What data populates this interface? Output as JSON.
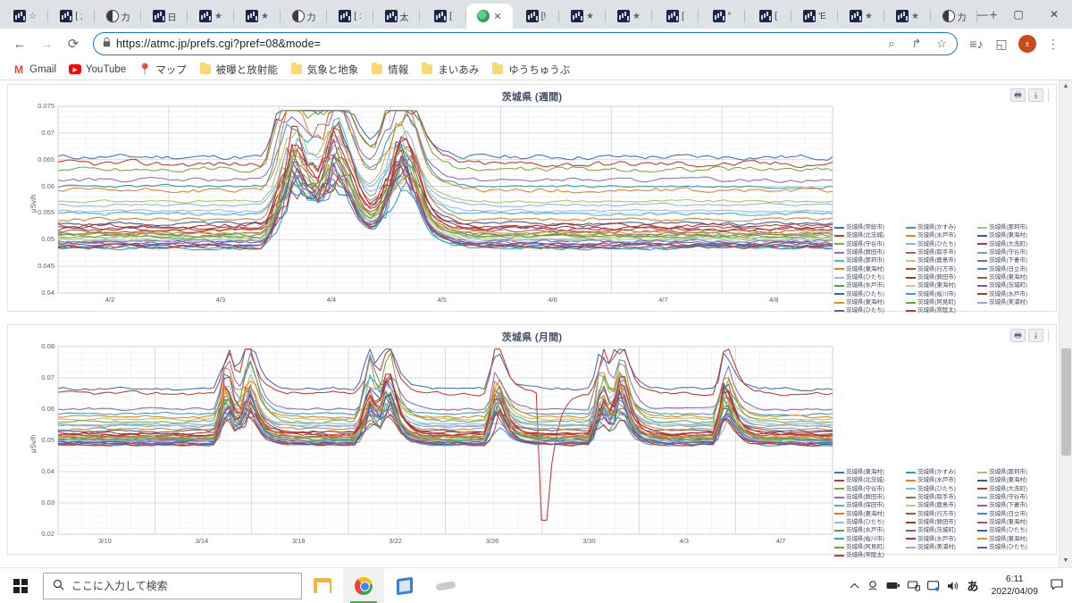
{
  "window": {
    "minimize": "—",
    "maximize": "▢",
    "close": "✕",
    "tab_list_chevron": "⌄"
  },
  "tabs": [
    {
      "favicon": "chart-favicon",
      "text": "",
      "trailing": "☆",
      "active": false
    },
    {
      "favicon": "chart-favicon",
      "text": "[ ;",
      "trailing": "",
      "active": false
    },
    {
      "favicon": "globe-favicon",
      "text": "力",
      "trailing": "",
      "active": false
    },
    {
      "favicon": "chart-favicon",
      "text": "日",
      "trailing": "",
      "active": false
    },
    {
      "favicon": "chart-favicon",
      "text": "",
      "trailing": "★",
      "active": false
    },
    {
      "favicon": "chart-favicon",
      "text": "",
      "trailing": "★",
      "active": false
    },
    {
      "favicon": "globe-favicon",
      "text": "力",
      "trailing": "",
      "active": false
    },
    {
      "favicon": "chart-favicon",
      "text": "[ :",
      "trailing": "",
      "active": false
    },
    {
      "favicon": "chart-favicon",
      "text": "太",
      "trailing": "",
      "active": false
    },
    {
      "favicon": "chart-favicon",
      "text": "[",
      "trailing": "",
      "active": false
    },
    {
      "favicon": "world-favicon",
      "text": "",
      "trailing": "✕",
      "active": true
    },
    {
      "favicon": "chart-favicon",
      "text": "[!",
      "trailing": "",
      "active": false
    },
    {
      "favicon": "chart-favicon",
      "text": "",
      "trailing": "★",
      "active": false
    },
    {
      "favicon": "chart-favicon",
      "text": "",
      "trailing": "★",
      "active": false
    },
    {
      "favicon": "chart-favicon",
      "text": "[",
      "trailing": "",
      "active": false
    },
    {
      "favicon": "chart-favicon",
      "text": "°",
      "trailing": "",
      "active": false
    },
    {
      "favicon": "chart-favicon",
      "text": "[",
      "trailing": "",
      "active": false
    },
    {
      "favicon": "chart-favicon",
      "text": "'E",
      "trailing": "",
      "active": false
    },
    {
      "favicon": "chart-favicon",
      "text": "",
      "trailing": "★",
      "active": false
    },
    {
      "favicon": "chart-favicon",
      "text": "",
      "trailing": "★",
      "active": false
    },
    {
      "favicon": "globe-favicon",
      "text": "力",
      "trailing": "",
      "active": false
    }
  ],
  "newtab_label": "+",
  "toolbar": {
    "back": "←",
    "forward": "→",
    "reload": "⟳",
    "url": "https://atmc.jp/prefs.cgi?pref=08&mode=",
    "url_bold_part": "atmc.jp",
    "lock_icon": "🔒",
    "omni_search": "⌕",
    "omni_share": "↱",
    "omni_star": "☆",
    "reading_list": "≡♪",
    "side_panel": "◱",
    "avatar_letter": "±",
    "menu": "⋮"
  },
  "bookmarks": [
    {
      "icon": "gmail-icon",
      "label": "Gmail"
    },
    {
      "icon": "youtube-icon",
      "label": "YouTube"
    },
    {
      "icon": "maps-pin-icon",
      "label": "マップ"
    },
    {
      "icon": "folder-icon",
      "label": "被曝と放射能"
    },
    {
      "icon": "folder-icon",
      "label": "気象と地象"
    },
    {
      "icon": "folder-icon",
      "label": "情報"
    },
    {
      "icon": "folder-icon",
      "label": "まいあみ"
    },
    {
      "icon": "folder-icon",
      "label": "ゆうちゅうぶ"
    }
  ],
  "chart_tools": {
    "print": "🖶",
    "download": "⤓"
  },
  "chart_data": [
    {
      "type": "line",
      "title": "茨城県 (週間)",
      "xlabel": "",
      "ylabel": "μSv/h",
      "ylim": [
        0.04,
        0.075
      ],
      "yticks": [
        "0.075",
        "0.07",
        "0.065",
        "0.06",
        "0.055",
        "0.05",
        "0.045",
        "0.04"
      ],
      "xticks": [
        "4/2",
        "4/3",
        "4/4",
        "4/5",
        "4/6",
        "4/7",
        "4/8"
      ],
      "grid": true,
      "legend_position": "right",
      "series": [
        {
          "name": "茨城県(常総市)",
          "color": "#3c6fb5",
          "baseline": 0.0655,
          "amp": 0.002,
          "seed": 11
        },
        {
          "name": "茨城県(かすみ)",
          "color": "#2e9fb8",
          "baseline": 0.06,
          "amp": 0.0012,
          "seed": 23
        },
        {
          "name": "茨城県(那珂市)",
          "color": "#a9c46c",
          "baseline": 0.0572,
          "amp": 0.001,
          "seed": 31
        },
        {
          "name": "茨城県(北茨城)",
          "color": "#c0392b",
          "baseline": 0.0642,
          "amp": 0.0025,
          "seed": 42
        },
        {
          "name": "茨城県(水戸市)",
          "color": "#e8821e",
          "baseline": 0.0592,
          "amp": 0.0018,
          "seed": 57
        },
        {
          "name": "茨城県(東海村)",
          "color": "#2e5f9e",
          "baseline": 0.053,
          "amp": 0.0014,
          "seed": 63
        },
        {
          "name": "茨城県(守谷市)",
          "color": "#7ba83c",
          "baseline": 0.0632,
          "amp": 0.0022,
          "seed": 74
        },
        {
          "name": "茨城県(ひたち)",
          "color": "#93b3d8",
          "baseline": 0.0565,
          "amp": 0.001,
          "seed": 85
        },
        {
          "name": "茨城県(大洗町)",
          "color": "#b03a3a",
          "baseline": 0.052,
          "amp": 0.0016,
          "seed": 96
        },
        {
          "name": "茨城県(鉾田市)",
          "color": "#8e6fae",
          "baseline": 0.0612,
          "amp": 0.0016,
          "seed": 107
        },
        {
          "name": "茨城県(取手市)",
          "color": "#9c6b55",
          "baseline": 0.0512,
          "amp": 0.0013,
          "seed": 118
        },
        {
          "name": "茨城県(守谷市)",
          "color": "#6fae8e",
          "baseline": 0.0505,
          "amp": 0.0012,
          "seed": 129
        },
        {
          "name": "茨城県(那珂市)",
          "color": "#4fb7c9",
          "baseline": 0.0548,
          "amp": 0.0015,
          "seed": 140
        },
        {
          "name": "茨城県(鹿島市)",
          "color": "#b9cf8a",
          "baseline": 0.05,
          "amp": 0.0011,
          "seed": 151
        },
        {
          "name": "茨城県(下妻市)",
          "color": "#8b5fa8",
          "baseline": 0.0497,
          "amp": 0.0014,
          "seed": 162
        },
        {
          "name": "茨城県(東海村)",
          "color": "#e07b28",
          "baseline": 0.0538,
          "amp": 0.0013,
          "seed": 173
        },
        {
          "name": "茨城県(行方市)",
          "color": "#a6543f",
          "baseline": 0.0492,
          "amp": 0.0012,
          "seed": 184
        },
        {
          "name": "茨城県(日立市)",
          "color": "#3a93c4",
          "baseline": 0.0486,
          "amp": 0.0012,
          "seed": 195
        },
        {
          "name": "茨城県(ひたち)",
          "color": "#9bb7dd",
          "baseline": 0.0554,
          "amp": 0.001,
          "seed": 206
        },
        {
          "name": "茨城県(鉾田市)",
          "color": "#b5322c",
          "baseline": 0.0527,
          "amp": 0.0018,
          "seed": 217
        },
        {
          "name": "茨城県(東海村)",
          "color": "#a05a52",
          "baseline": 0.0516,
          "amp": 0.0014,
          "seed": 228
        },
        {
          "name": "茨城県(水戸市)",
          "color": "#5a9e45",
          "baseline": 0.0509,
          "amp": 0.0013,
          "seed": 239
        },
        {
          "name": "茨城県(東海村)",
          "color": "#b7cf84",
          "baseline": 0.0503,
          "amp": 0.0012,
          "seed": 250
        },
        {
          "name": "茨城県(茨城町)",
          "color": "#7a5ba0",
          "baseline": 0.0494,
          "amp": 0.0013,
          "seed": 261
        },
        {
          "name": "茨城県(ひたち)",
          "color": "#32659e",
          "baseline": 0.0489,
          "amp": 0.0012,
          "seed": 272
        },
        {
          "name": "茨城県(桜川市)",
          "color": "#2fa8b5",
          "baseline": 0.0484,
          "amp": 0.0011,
          "seed": 283
        },
        {
          "name": "茨城県(水戸市)",
          "color": "#bb2f2f",
          "baseline": 0.0522,
          "amp": 0.0015,
          "seed": 294
        },
        {
          "name": "茨城県(東海村)",
          "color": "#e8901f",
          "baseline": 0.0512,
          "amp": 0.0014,
          "seed": 305
        },
        {
          "name": "茨城県(阿見町)",
          "color": "#6ea33a",
          "baseline": 0.0506,
          "amp": 0.0013,
          "seed": 316
        },
        {
          "name": "茨城県(美浦村)",
          "color": "#8fb0d6",
          "baseline": 0.0498,
          "amp": 0.0012,
          "seed": 327
        },
        {
          "name": "茨城県(ひたち)",
          "color": "#7b55a5",
          "baseline": 0.0491,
          "amp": 0.0012,
          "seed": 338
        },
        {
          "name": "茨城県(常陸太)",
          "color": "#c03a2e",
          "baseline": 0.0487,
          "amp": 0.0013,
          "seed": 349
        }
      ]
    },
    {
      "type": "line",
      "title": "茨城県 (月間)",
      "xlabel": "",
      "ylabel": "μSv/h",
      "ylim": [
        0.02,
        0.08
      ],
      "yticks": [
        "0.08",
        "0.07",
        "0.06",
        "0.05",
        "0.04",
        "0.03",
        "0.02"
      ],
      "xticks": [
        "3/10",
        "3/14",
        "3/18",
        "3/22",
        "3/26",
        "3/30",
        "4/3",
        "4/7"
      ],
      "grid": true,
      "legend_position": "right",
      "series": [
        {
          "name": "茨城県(東海村)",
          "color": "#3c6fb5",
          "baseline": 0.0665,
          "amp": 0.0022,
          "seed": 11
        },
        {
          "name": "茨城県(かすみ)",
          "color": "#2e9fb8",
          "baseline": 0.0585,
          "amp": 0.0015,
          "seed": 23
        },
        {
          "name": "茨城県(那珂市)",
          "color": "#a9c46c",
          "baseline": 0.0568,
          "amp": 0.0014,
          "seed": 31
        },
        {
          "name": "茨城県(北茨城)",
          "color": "#c0392b",
          "baseline": 0.065,
          "amp": 0.0026,
          "seed": 42
        },
        {
          "name": "茨城県(水戸市)",
          "color": "#e8821e",
          "baseline": 0.0575,
          "amp": 0.0018,
          "seed": 57
        },
        {
          "name": "茨城県(東海村)",
          "color": "#2e5f9e",
          "baseline": 0.053,
          "amp": 0.0016,
          "seed": 63
        },
        {
          "name": "茨城県(守谷市)",
          "color": "#7ba83c",
          "baseline": 0.056,
          "amp": 0.0022,
          "seed": 74
        },
        {
          "name": "茨城県(ひたち)",
          "color": "#93b3d8",
          "baseline": 0.0552,
          "amp": 0.0012,
          "seed": 85
        },
        {
          "name": "茨城県(大洗町)",
          "color": "#b03a3a",
          "baseline": 0.0518,
          "amp": 0.0018,
          "seed": 96
        },
        {
          "name": "茨城県(鉾田市)",
          "color": "#8e6fae",
          "baseline": 0.06,
          "amp": 0.0018,
          "seed": 107
        },
        {
          "name": "茨城県(取手市)",
          "color": "#9c6b55",
          "baseline": 0.0512,
          "amp": 0.0015,
          "seed": 118
        },
        {
          "name": "茨城県(守谷市)",
          "color": "#6fae8e",
          "baseline": 0.0505,
          "amp": 0.0014,
          "seed": 129
        },
        {
          "name": "茨城県(保田市)",
          "color": "#4fb7c9",
          "baseline": 0.0545,
          "amp": 0.0016,
          "seed": 140
        },
        {
          "name": "茨城県(鹿島市)",
          "color": "#b9cf8a",
          "baseline": 0.05,
          "amp": 0.0013,
          "seed": 151
        },
        {
          "name": "茨城県(下妻市)",
          "color": "#8b5fa8",
          "baseline": 0.0496,
          "amp": 0.0015,
          "seed": 162
        },
        {
          "name": "茨城県(東海村)",
          "color": "#e07b28",
          "baseline": 0.0536,
          "amp": 0.0015,
          "seed": 173
        },
        {
          "name": "茨城県(行方市)",
          "color": "#a6543f",
          "baseline": 0.049,
          "amp": 0.0014,
          "seed": 184
        },
        {
          "name": "茨城県(日立市)",
          "color": "#3a93c4",
          "baseline": 0.0485,
          "amp": 0.0014,
          "seed": 195
        },
        {
          "name": "茨城県(ひたち)",
          "color": "#9bb7dd",
          "baseline": 0.0548,
          "amp": 0.0012,
          "seed": 206
        },
        {
          "name": "茨城県(鉾田市)",
          "color": "#b5322c",
          "baseline": 0.0525,
          "amp": 0.002,
          "seed": 217
        },
        {
          "name": "茨城県(東海村)",
          "color": "#a05a52",
          "baseline": 0.0515,
          "amp": 0.0016,
          "seed": 228
        },
        {
          "name": "茨城県(水戸市)",
          "color": "#5a9e45",
          "baseline": 0.0508,
          "amp": 0.0015,
          "seed": 239
        },
        {
          "name": "茨城県(茨城町)",
          "color": "#7a5ba0",
          "baseline": 0.0502,
          "amp": 0.0014,
          "seed": 250
        },
        {
          "name": "茨城県(ひたち)",
          "color": "#32659e",
          "baseline": 0.0494,
          "amp": 0.0014,
          "seed": 261
        },
        {
          "name": "茨城県(桜川市)",
          "color": "#2fa8b5",
          "baseline": 0.0488,
          "amp": 0.0013,
          "seed": 272
        },
        {
          "name": "茨城県(水戸市)",
          "color": "#bb2f2f",
          "baseline": 0.052,
          "amp": 0.0017,
          "seed": 283
        },
        {
          "name": "茨城県(東海村)",
          "color": "#e8901f",
          "baseline": 0.0511,
          "amp": 0.0016,
          "seed": 294
        },
        {
          "name": "茨城県(阿見町)",
          "color": "#6ea33a",
          "baseline": 0.0504,
          "amp": 0.0015,
          "seed": 305
        },
        {
          "name": "茨城県(美浦村)",
          "color": "#8fb0d6",
          "baseline": 0.0497,
          "amp": 0.0013,
          "seed": 316
        },
        {
          "name": "茨城県(ひたち)",
          "color": "#7b55a5",
          "baseline": 0.0491,
          "amp": 0.0014,
          "seed": 327
        },
        {
          "name": "茨城県(常陸太)",
          "color": "#c03a2e",
          "baseline": 0.0486,
          "amp": 0.0015,
          "seed": 338
        }
      ]
    }
  ],
  "taskbar": {
    "search_placeholder": "ここに入力して検索",
    "search_icon": "⌕",
    "apps": [
      {
        "icon": "file-explorer-icon",
        "active": false
      },
      {
        "icon": "chrome-icon",
        "active": true
      },
      {
        "icon": "notebook-icon",
        "active": false
      },
      {
        "icon": "pen-icon",
        "active": false
      }
    ],
    "tray": [
      "∧",
      "🖧",
      "🔋",
      "🖥",
      "🖼",
      "🔊"
    ],
    "ime": "あ",
    "time": "6:11",
    "date": "2022/04/09",
    "notification": "🗩"
  }
}
